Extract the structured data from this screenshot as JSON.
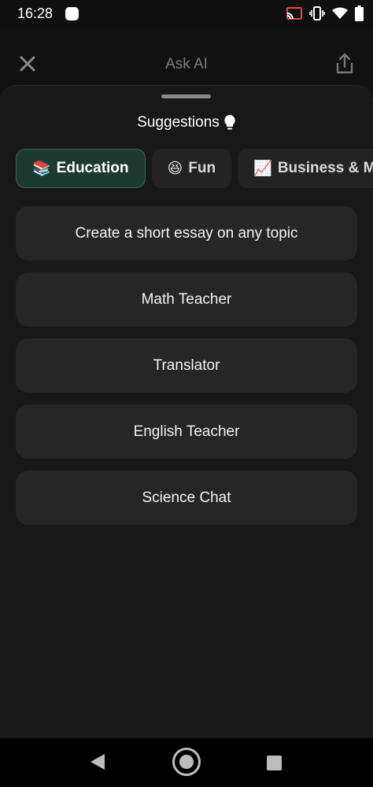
{
  "status_bar": {
    "time": "16:28",
    "icons": [
      "cast-icon",
      "vibrate-icon",
      "wifi-icon",
      "battery-icon"
    ]
  },
  "header": {
    "title": "Ask AI",
    "close_icon": "close-icon",
    "share_icon": "share-icon"
  },
  "sheet": {
    "title": "Suggestions",
    "title_icon": "lightbulb-icon",
    "chips": [
      {
        "emoji": "📚",
        "label": "Education",
        "active": true
      },
      {
        "emoji": "😆",
        "label": "Fun",
        "active": false
      },
      {
        "emoji": "📈",
        "label": "Business & Ma",
        "active": false
      }
    ],
    "suggestions": [
      {
        "label": "Create a short essay on any topic"
      },
      {
        "label": "Math Teacher"
      },
      {
        "label": "Translator"
      },
      {
        "label": "English Teacher"
      },
      {
        "label": "Science Chat"
      }
    ]
  },
  "colors": {
    "accent_chip_bg": "#1c3a30",
    "accent_chip_border": "#2f6b54",
    "card_bg": "#262626",
    "sheet_bg": "#181818"
  },
  "nav": {
    "back": "back-icon",
    "home": "home-icon",
    "recents": "recents-icon"
  }
}
